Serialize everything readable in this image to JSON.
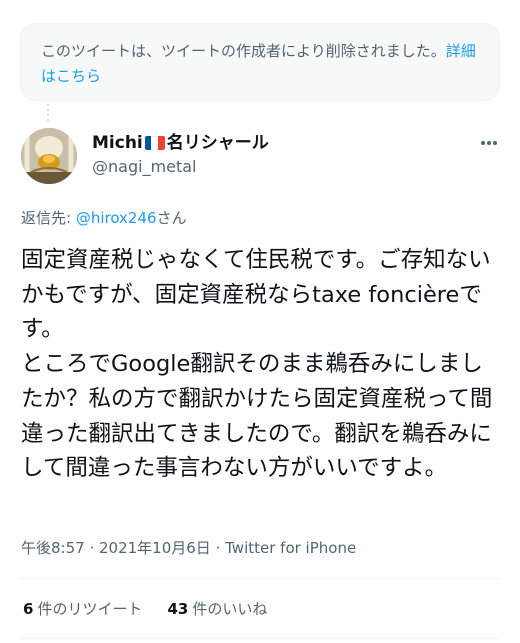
{
  "deleted_notice": {
    "text": "このツイートは、ツイートの作成者により削除されました。",
    "link": "詳細はこちら"
  },
  "author": {
    "name_prefix": "Michi",
    "name_suffix": "名リシャール",
    "flag_colors": [
      "#0055a4",
      "#ffffff",
      "#ef4135"
    ],
    "handle": "@nagi_metal"
  },
  "reply": {
    "label": "返信先: ",
    "handle": "@hirox246",
    "suffix": "さん"
  },
  "tweet": {
    "text": "固定資産税じゃなくて住民税です。ご存知ないかもですが、固定資産税ならtaxe foncièreです。\nところでGoogle翻訳そのまま鵜呑みにしましたか？私の方で翻訳かけたら固定資産税って間違った翻訳出てきましたので。翻訳を鵜呑みにして間違った事言わない方がいいですよ。"
  },
  "meta": {
    "time": "午後8:57",
    "date": "2021年10月6日",
    "source": "Twitter for iPhone"
  },
  "stats": {
    "retweets_count": "6",
    "retweets_label": "件のリツイート",
    "likes_count": "43",
    "likes_label": "件のいいね"
  },
  "colors": {
    "link": "#1d9bf0",
    "secondary_text": "#536471",
    "primary_text": "#0f1419"
  }
}
